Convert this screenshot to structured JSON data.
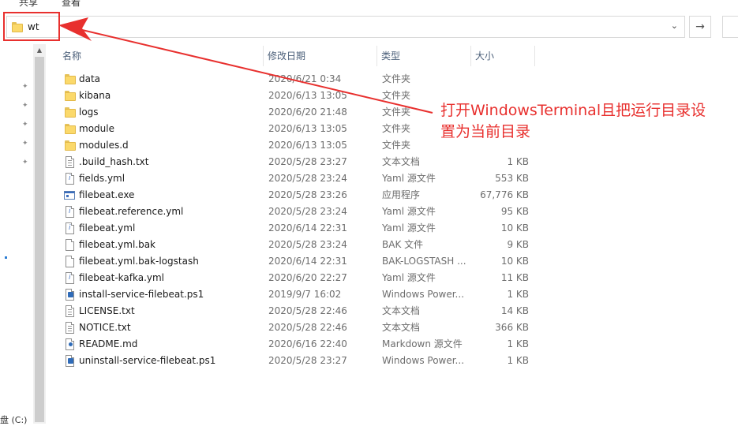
{
  "ribbon": {
    "tab_share": "共享",
    "tab_view": "查看"
  },
  "address": {
    "path": "wt"
  },
  "nav": {
    "forward_glyph": "→",
    "up_glyph": "↑"
  },
  "left_pane": {
    "drive_label": "盘 (C:)"
  },
  "columns": {
    "name": "名称",
    "date": "修改日期",
    "type": "类型",
    "size": "大小"
  },
  "files": [
    {
      "icon": "folder-icon",
      "name": "data",
      "date": "2020/6/21 0:34",
      "type": "文件夹",
      "size": ""
    },
    {
      "icon": "folder-icon",
      "name": "kibana",
      "date": "2020/6/13 13:05",
      "type": "文件夹",
      "size": ""
    },
    {
      "icon": "folder-icon",
      "name": "logs",
      "date": "2020/6/20 21:48",
      "type": "文件夹",
      "size": ""
    },
    {
      "icon": "folder-icon",
      "name": "module",
      "date": "2020/6/13 13:05",
      "type": "文件夹",
      "size": ""
    },
    {
      "icon": "folder-icon",
      "name": "modules.d",
      "date": "2020/6/13 13:05",
      "type": "文件夹",
      "size": ""
    },
    {
      "icon": "text-file-icon",
      "name": ".build_hash.txt",
      "date": "2020/5/28 23:27",
      "type": "文本文档",
      "size": "1 KB"
    },
    {
      "icon": "yml-file-icon",
      "name": "fields.yml",
      "date": "2020/5/28 23:24",
      "type": "Yaml 源文件",
      "size": "553 KB"
    },
    {
      "icon": "exe-icon",
      "name": "filebeat.exe",
      "date": "2020/5/28 23:26",
      "type": "应用程序",
      "size": "67,776 KB"
    },
    {
      "icon": "yml-file-icon",
      "name": "filebeat.reference.yml",
      "date": "2020/5/28 23:24",
      "type": "Yaml 源文件",
      "size": "95 KB"
    },
    {
      "icon": "yml-file-icon",
      "name": "filebeat.yml",
      "date": "2020/6/14 22:31",
      "type": "Yaml 源文件",
      "size": "10 KB"
    },
    {
      "icon": "blank-file-icon",
      "name": "filebeat.yml.bak",
      "date": "2020/5/28 23:24",
      "type": "BAK 文件",
      "size": "9 KB"
    },
    {
      "icon": "blank-file-icon",
      "name": "filebeat.yml.bak-logstash",
      "date": "2020/6/14 22:31",
      "type": "BAK-LOGSTASH ...",
      "size": "10 KB"
    },
    {
      "icon": "yml-file-icon",
      "name": "filebeat-kafka.yml",
      "date": "2020/6/20 22:27",
      "type": "Yaml 源文件",
      "size": "11 KB"
    },
    {
      "icon": "powershell-file-icon",
      "name": "install-service-filebeat.ps1",
      "date": "2019/9/7 16:02",
      "type": "Windows Power...",
      "size": "1 KB"
    },
    {
      "icon": "text-file-icon",
      "name": "LICENSE.txt",
      "date": "2020/5/28 22:46",
      "type": "文本文档",
      "size": "14 KB"
    },
    {
      "icon": "text-file-icon",
      "name": "NOTICE.txt",
      "date": "2020/5/28 22:46",
      "type": "文本文档",
      "size": "366 KB"
    },
    {
      "icon": "markdown-file-icon",
      "name": "README.md",
      "date": "2020/6/16 22:40",
      "type": "Markdown 源文件",
      "size": "1 KB"
    },
    {
      "icon": "powershell-file-icon",
      "name": "uninstall-service-filebeat.ps1",
      "date": "2020/5/28 23:27",
      "type": "Windows Power...",
      "size": "1 KB"
    }
  ],
  "annotation": {
    "text": "打开WindowsTerminal且把运行目录设置为当前目录",
    "color": "#e8302e"
  },
  "colors": {
    "highlight": "#e8302e",
    "header_text": "#4c607a",
    "folder": "#fbd96b"
  }
}
